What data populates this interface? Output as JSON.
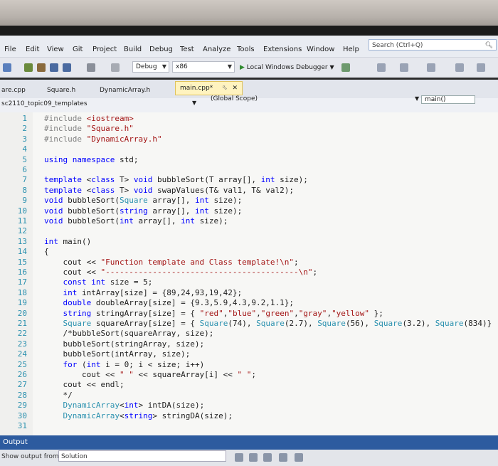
{
  "menu": {
    "items": [
      "File",
      "Edit",
      "View",
      "Git",
      "Project",
      "Build",
      "Debug",
      "Test",
      "Analyze",
      "Tools",
      "Extensions",
      "Window",
      "Help"
    ],
    "search_placeholder": "Search (Ctrl+Q)"
  },
  "toolbar": {
    "configuration": "Debug",
    "platform": "x86",
    "run_label": "Local Windows Debugger"
  },
  "tabs": [
    {
      "label": "are.cpp",
      "active": false
    },
    {
      "label": "Square.h",
      "active": false
    },
    {
      "label": "DynamicArray.h",
      "active": false
    },
    {
      "label": "main.cpp*",
      "active": true
    }
  ],
  "navbar": {
    "project": "sc2110_topic09_templates",
    "scope": "(Global Scope)",
    "member": "main()"
  },
  "code_lines": [
    {
      "n": "1",
      "text": "#include <iostream>"
    },
    {
      "n": "2",
      "text": "#include \"Square.h\""
    },
    {
      "n": "3",
      "text": "#include \"DynamicArray.h\""
    },
    {
      "n": "4",
      "text": ""
    },
    {
      "n": "5",
      "text": "using namespace std;"
    },
    {
      "n": "6",
      "text": ""
    },
    {
      "n": "7",
      "text": "template <class T> void bubbleSort(T array[], int size);"
    },
    {
      "n": "8",
      "text": "template <class T> void swapValues(T& val1, T& val2);"
    },
    {
      "n": "9",
      "text": "void bubbleSort(Square array[], int size);"
    },
    {
      "n": "10",
      "text": "void bubbleSort(string array[], int size);"
    },
    {
      "n": "11",
      "text": "void bubbleSort(int array[], int size);"
    },
    {
      "n": "12",
      "text": ""
    },
    {
      "n": "13",
      "text": "int main()"
    },
    {
      "n": "14",
      "text": "{"
    },
    {
      "n": "15",
      "text": "    cout << \"Function template and Class template!\\n\";"
    },
    {
      "n": "16",
      "text": "    cout << \"-----------------------------------------\\n\";"
    },
    {
      "n": "17",
      "text": "    const int size = 5;"
    },
    {
      "n": "18",
      "text": "    int intArray[size] = {89,24,93,19,42};"
    },
    {
      "n": "19",
      "text": "    double doubleArray[size] = {9.3,5.9,4.3,9.2,1.1};"
    },
    {
      "n": "20",
      "text": "    string stringArray[size] = { \"red\",\"blue\",\"green\",\"gray\",\"yellow\" };"
    },
    {
      "n": "21",
      "text": "    Square squareArray[size] = { Square(74), Square(2.7), Square(56), Square(3.2), Square(834)}"
    },
    {
      "n": "22",
      "text": "    /*bubbleSort(squareArray, size);"
    },
    {
      "n": "23",
      "text": "    bubbleSort(stringArray, size);"
    },
    {
      "n": "24",
      "text": "    bubbleSort(intArray, size);"
    },
    {
      "n": "25",
      "text": "    for (int i = 0; i < size; i++)"
    },
    {
      "n": "26",
      "text": "        cout << \" \" << squareArray[i] << \" \";"
    },
    {
      "n": "27",
      "text": "    cout << endl;"
    },
    {
      "n": "28",
      "text": "    */"
    },
    {
      "n": "29",
      "text": "    DynamicArray<int> intDA(size);"
    },
    {
      "n": "30",
      "text": "    DynamicArray<string> stringDA(size);"
    },
    {
      "n": "31",
      "text": ""
    }
  ],
  "output": {
    "title": "Output",
    "show_from_label": "Show output from:",
    "source": "Solution"
  },
  "colors": {
    "keyword": "#0000ff",
    "string": "#a31515",
    "preprocessor": "#808080",
    "line_numbers": "#2b91af",
    "output_bar": "#2d5b9f",
    "active_tab": "#fff3bf"
  }
}
